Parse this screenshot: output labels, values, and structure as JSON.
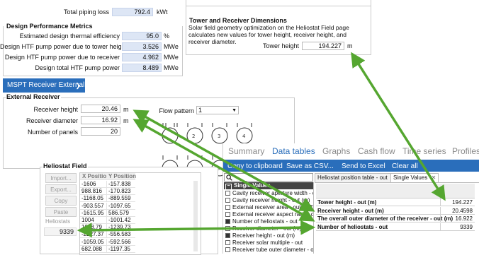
{
  "piping": {
    "label": "Total piping loss",
    "value": "792.4",
    "unit": "kWt"
  },
  "design": {
    "title": "Design Performance Metrics",
    "rows": [
      {
        "label": "Estimated design thermal efficiency",
        "value": "95.0",
        "unit": "%"
      },
      {
        "label": "Design HTF pump power due to tower height",
        "value": "3.526",
        "unit": "MWe"
      },
      {
        "label": "Design HTF pump power due to receiver",
        "value": "4.962",
        "unit": "MWe"
      },
      {
        "label": "Design total HTF pump power",
        "value": "8.489",
        "unit": "MWe"
      }
    ]
  },
  "tower": {
    "title": "Tower and Receiver Dimensions",
    "description": "Solar field geometry optimization on the Heliostat Field page calculates new values for tower height, receiver height, and receiver diameter.",
    "height_label": "Tower height",
    "height_value": "194.227",
    "height_unit": "m"
  },
  "receiver_menu": {
    "label": "MSPT Receiver External"
  },
  "external": {
    "title": "External Receiver",
    "rows": [
      {
        "label": "Receiver height",
        "value": "20.46",
        "unit": "m"
      },
      {
        "label": "Receiver diameter",
        "value": "16.92",
        "unit": "m"
      },
      {
        "label": "Number of panels",
        "value": "20",
        "unit": ""
      }
    ],
    "flow_label": "Flow pattern",
    "flow_value": "1"
  },
  "heliostat": {
    "title": "Heliostat Field",
    "buttons": [
      "Import...",
      "Export...",
      "Copy",
      "Paste"
    ],
    "heliostats_label": "Heliostats",
    "count": "9339",
    "columns": [
      "X Position",
      "Y Position"
    ],
    "rows": [
      [
        "-1606",
        "-157.838"
      ],
      [
        "988.816",
        "-170.823"
      ],
      [
        "-1168.05",
        "-889.559"
      ],
      [
        "-903.557",
        "-1097.65"
      ],
      [
        "-1615.95",
        "586.579"
      ],
      [
        "1004",
        "-1001.42"
      ],
      [
        "1008.79",
        "-1239.73"
      ],
      [
        "-2227.37",
        "-556.583"
      ],
      [
        "-1059.05",
        "-592.566"
      ],
      [
        "682.088",
        "-1197.35"
      ]
    ]
  },
  "results": {
    "tabs": [
      "Summary",
      "Data tables",
      "Graphs",
      "Cash flow",
      "Time series",
      "Profiles"
    ],
    "active_tab": "Data tables",
    "toolbar": [
      "Copy to clipboard",
      "Save as CSV...",
      "Send to Excel",
      "Clear all"
    ],
    "search_icon": "search-icon",
    "group": "Single Values",
    "vars": [
      {
        "label": "Cavity receiver aperture width - out",
        "checked": false
      },
      {
        "label": "Cavity receiver height - out (m)",
        "checked": false
      },
      {
        "label": "External receiver area - out (m2)",
        "checked": false
      },
      {
        "label": "External receiver aspect ratio - out",
        "checked": false
      },
      {
        "label": "Number of heliostats - out",
        "checked": true
      },
      {
        "label": "Receiver diameter - out (m)",
        "checked": false
      },
      {
        "label": "Receiver height - out (m)",
        "checked": true
      },
      {
        "label": "Receiver solar multiple - out",
        "checked": false
      },
      {
        "label": "Receiver tube outer diameter - out",
        "checked": false
      }
    ],
    "subtabs": [
      "Heliostat position table - out",
      "Single Values"
    ],
    "close_icon": "close-icon",
    "single_values": [
      {
        "name": "Tower height - out (m)",
        "value": "194.227"
      },
      {
        "name": "Receiver height - out (m)",
        "value": "20.4598"
      },
      {
        "name": "The overall outer diameter of the receiver - out (m)",
        "value": "16.922"
      },
      {
        "name": "Number of heliostats - out",
        "value": "9339"
      }
    ]
  },
  "colors": {
    "accent": "#2a6ebb",
    "field": "#dde6f5",
    "arrow": "#55a630"
  }
}
